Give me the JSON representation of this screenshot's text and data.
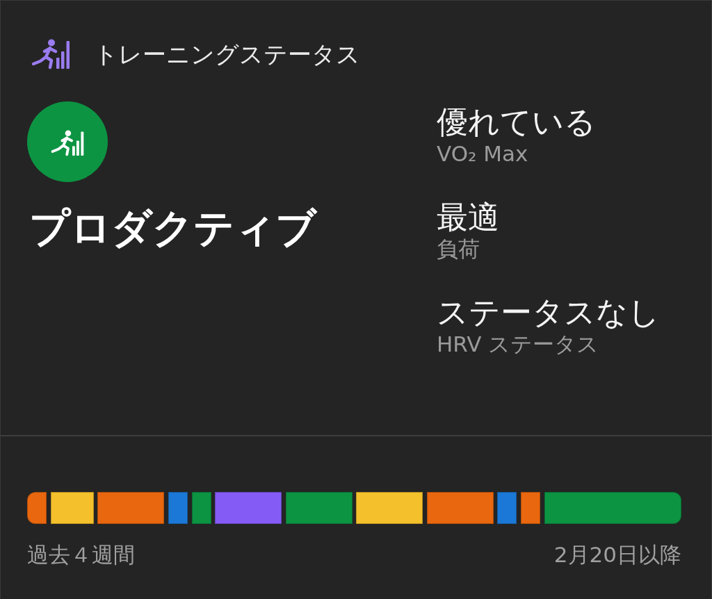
{
  "header": {
    "title": "トレーニングステータス"
  },
  "status": {
    "label": "プロダクティブ"
  },
  "metrics": [
    {
      "value": "優れている",
      "label": "VO₂ Max"
    },
    {
      "value": "最適",
      "label": "負荷"
    },
    {
      "value": "ステータスなし",
      "label": "HRV ステータス"
    }
  ],
  "history": {
    "days": [
      {
        "color": "#e8670f"
      },
      {
        "color": "#f4c02c"
      },
      {
        "color": "#f4c02c"
      },
      {
        "color": "#e8670f"
      },
      {
        "color": "#e8670f"
      },
      {
        "color": "#e8670f"
      },
      {
        "color": "#1c78d6"
      },
      {
        "color": "#0c9442"
      },
      {
        "color": "#845cf5"
      },
      {
        "color": "#845cf5"
      },
      {
        "color": "#845cf5"
      },
      {
        "color": "#0c9442"
      },
      {
        "color": "#0c9442"
      },
      {
        "color": "#0c9442"
      },
      {
        "color": "#f4c02c"
      },
      {
        "color": "#f4c02c"
      },
      {
        "color": "#f4c02c"
      },
      {
        "color": "#e8670f"
      },
      {
        "color": "#e8670f"
      },
      {
        "color": "#e8670f"
      },
      {
        "color": "#1c78d6"
      },
      {
        "color": "#e8670f"
      },
      {
        "color": "#0c9442"
      },
      {
        "color": "#0c9442"
      },
      {
        "color": "#0c9442"
      },
      {
        "color": "#0c9442"
      },
      {
        "color": "#0c9442"
      },
      {
        "color": "#0c9442"
      }
    ],
    "start_label": "過去４週間",
    "end_label": "2月20日以降"
  }
}
